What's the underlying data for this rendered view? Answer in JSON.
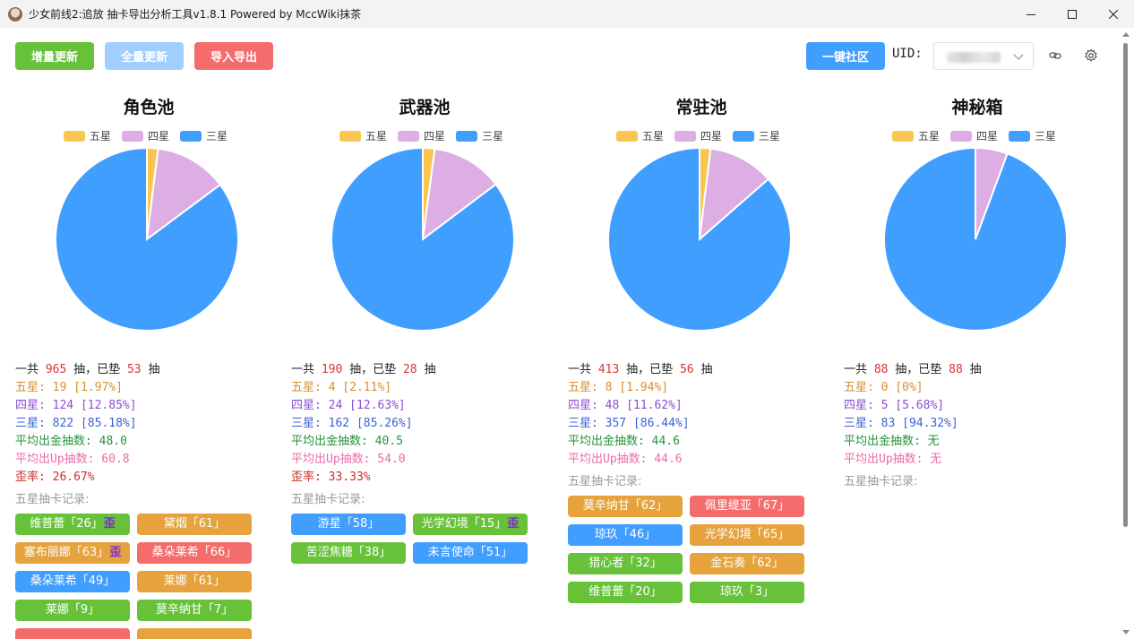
{
  "window": {
    "title": "少女前线2:追放 抽卡导出分析工具v1.8.1 Powered by MccWiki抹茶"
  },
  "toolbar": {
    "incremental_update": "增量更新",
    "full_update": "全量更新",
    "import_export": "导入导出",
    "community": "一键社区",
    "uid_label": "UID:"
  },
  "legend": {
    "five": "五星",
    "four": "四星",
    "three": "三星"
  },
  "colors": {
    "five": "#f9c74f",
    "four": "#dcaee3",
    "three": "#409eff",
    "tag_green": "#67c23a",
    "tag_orange": "#e6a23c",
    "tag_blue": "#409eff",
    "tag_red": "#f56c6c"
  },
  "pools": [
    {
      "title": "角色池",
      "chart_data": {
        "type": "pie",
        "categories": [
          "五星",
          "四星",
          "三星"
        ],
        "values": [
          19,
          124,
          822
        ]
      },
      "total_prefix": "一共 ",
      "total": "965",
      "total_mid": " 抽，已垫 ",
      "pity": "53",
      "total_suffix": " 抽",
      "five": "五星: 19 [1.97%]",
      "four": "四星: 124 [12.85%]",
      "three": "三星: 822 [85.18%]",
      "avg_gold": "平均出金抽数: 48.0",
      "avg_up": "平均出Up抽数: 60.8",
      "wai_rate": "歪率: 26.67%",
      "records_label": "五星抽卡记录:",
      "records": [
        {
          "name": "维普蕾「26」",
          "color": "green",
          "wai": "歪"
        },
        {
          "name": "黛烟「61」",
          "color": "orange",
          "wai": ""
        },
        {
          "name": "塞布丽娜「63」",
          "color": "orange",
          "wai": "歪"
        },
        {
          "name": "桑朵莱希「66」",
          "color": "red",
          "wai": ""
        },
        {
          "name": "桑朵莱希「49」",
          "color": "blue",
          "wai": ""
        },
        {
          "name": "莱娜「61」",
          "color": "orange",
          "wai": ""
        },
        {
          "name": "莱娜「9」",
          "color": "green",
          "wai": ""
        },
        {
          "name": "莫辛纳甘「7」",
          "color": "green",
          "wai": ""
        }
      ]
    },
    {
      "title": "武器池",
      "chart_data": {
        "type": "pie",
        "categories": [
          "五星",
          "四星",
          "三星"
        ],
        "values": [
          4,
          24,
          162
        ]
      },
      "total_prefix": "一共 ",
      "total": "190",
      "total_mid": " 抽，已垫 ",
      "pity": "28",
      "total_suffix": " 抽",
      "five": "五星: 4 [2.11%]",
      "four": "四星: 24 [12.63%]",
      "three": "三星: 162 [85.26%]",
      "avg_gold": "平均出金抽数: 40.5",
      "avg_up": "平均出Up抽数: 54.0",
      "wai_rate": "歪率: 33.33%",
      "records_label": "五星抽卡记录:",
      "records": [
        {
          "name": "游星「58」",
          "color": "blue",
          "wai": ""
        },
        {
          "name": "光学幻境「15」",
          "color": "green",
          "wai": "歪"
        },
        {
          "name": "苦涩焦糖「38」",
          "color": "green",
          "wai": ""
        },
        {
          "name": "未言使命「51」",
          "color": "blue",
          "wai": ""
        }
      ]
    },
    {
      "title": "常驻池",
      "chart_data": {
        "type": "pie",
        "categories": [
          "五星",
          "四星",
          "三星"
        ],
        "values": [
          8,
          48,
          357
        ]
      },
      "total_prefix": "一共 ",
      "total": "413",
      "total_mid": " 抽，已垫 ",
      "pity": "56",
      "total_suffix": " 抽",
      "five": "五星: 8 [1.94%]",
      "four": "四星: 48 [11.62%]",
      "three": "三星: 357 [86.44%]",
      "avg_gold": "平均出金抽数: 44.6",
      "avg_up": "平均出Up抽数: 44.6",
      "wai_rate": "",
      "records_label": "五星抽卡记录:",
      "records": [
        {
          "name": "莫辛纳甘「62」",
          "color": "orange",
          "wai": ""
        },
        {
          "name": "佩里缇亚「67」",
          "color": "red",
          "wai": ""
        },
        {
          "name": "琼玖「46」",
          "color": "blue",
          "wai": ""
        },
        {
          "name": "光学幻境「65」",
          "color": "orange",
          "wai": ""
        },
        {
          "name": "猎心者「32」",
          "color": "green",
          "wai": ""
        },
        {
          "name": "金石奏「62」",
          "color": "orange",
          "wai": ""
        },
        {
          "name": "维普蕾「20」",
          "color": "green",
          "wai": ""
        },
        {
          "name": "琼玖「3」",
          "color": "green",
          "wai": ""
        }
      ]
    },
    {
      "title": "神秘箱",
      "chart_data": {
        "type": "pie",
        "categories": [
          "五星",
          "四星",
          "三星"
        ],
        "values": [
          0,
          5,
          83
        ]
      },
      "total_prefix": "一共 ",
      "total": "88",
      "total_mid": " 抽，已垫 ",
      "pity": "88",
      "total_suffix": " 抽",
      "five": "五星: 0 [0%]",
      "four": "四星: 5 [5.68%]",
      "three": "三星: 83 [94.32%]",
      "avg_gold": "平均出金抽数: 无",
      "avg_up": "平均出Up抽数: 无",
      "wai_rate": "",
      "records_label": "五星抽卡记录:",
      "records": []
    }
  ]
}
